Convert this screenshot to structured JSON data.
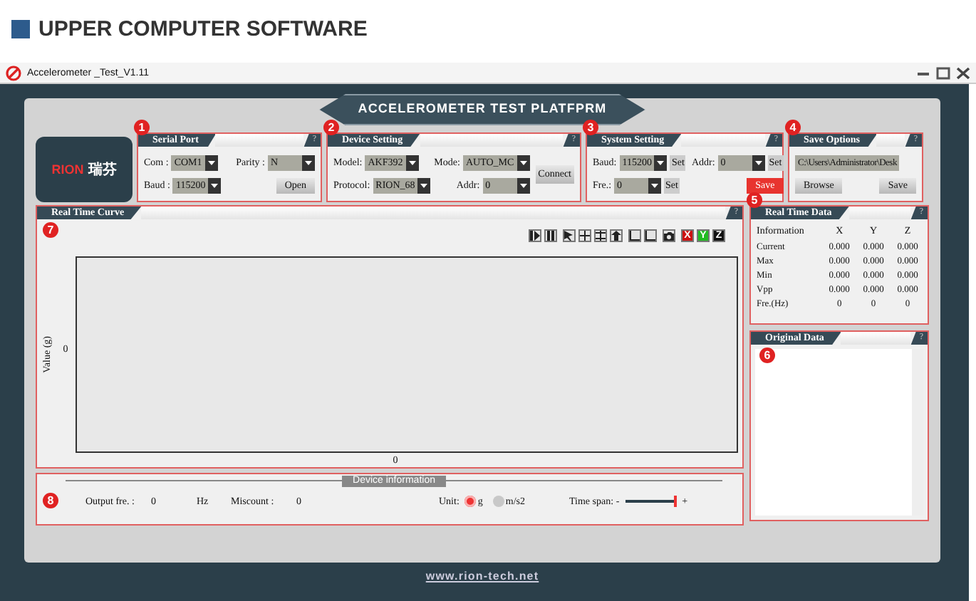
{
  "header": {
    "title": "UPPER COMPUTER SOFTWARE"
  },
  "window": {
    "title": "Accelerometer _Test_V1.11"
  },
  "banner": "ACCELEROMETER TEST PLATFPRM",
  "logo": {
    "brand": "RION",
    "chinese": "瑞芬"
  },
  "panels": [
    {
      "badge": "1",
      "title": "Serial Port",
      "help": "?",
      "rows": [
        [
          {
            "kind": "select",
            "label": "Com :",
            "value": "COM1"
          },
          {
            "kind": "select",
            "label": "Parity :",
            "value": "N"
          }
        ],
        [
          {
            "kind": "select",
            "label": "Baud :",
            "value": "115200"
          },
          {
            "kind": "button",
            "label": "Open"
          }
        ]
      ]
    },
    {
      "badge": "2",
      "title": "Device Setting",
      "help": "?",
      "rows": [
        [
          {
            "kind": "select",
            "label": "Model:",
            "value": "AKF392"
          },
          {
            "kind": "select",
            "label": "Mode:",
            "value": "AUTO_MC"
          }
        ],
        [
          {
            "kind": "select",
            "label": "Protocol:",
            "value": "RION_68"
          },
          {
            "kind": "select",
            "label": "Addr:",
            "value": "0"
          }
        ]
      ],
      "side_button": "Connect"
    },
    {
      "badge": "3",
      "title": "System Setting",
      "help": "?",
      "rows": [
        [
          {
            "kind": "select",
            "label": "Baud:",
            "value": "115200",
            "action": "Set"
          },
          {
            "kind": "select",
            "label": "Addr:",
            "value": "0",
            "action": "Set"
          }
        ],
        [
          {
            "kind": "select",
            "label": "Fre.:",
            "value": "0",
            "action": "Set"
          },
          {
            "kind": "alert-button",
            "label": "Save"
          }
        ]
      ]
    },
    {
      "badge": "4",
      "title": "Save Options",
      "help": "?",
      "rows": [
        [
          {
            "kind": "field",
            "value": "C:\\Users\\Administrator\\Desk"
          }
        ],
        [
          {
            "kind": "button",
            "label": "Browse"
          },
          {
            "kind": "button",
            "label": "Save"
          }
        ]
      ]
    }
  ],
  "curve": {
    "badge": "7",
    "title": "Real Time Curve",
    "help": "?",
    "axis_toggles": [
      {
        "label": "X",
        "color": "#cc1111"
      },
      {
        "label": "Y",
        "color": "#22bb22"
      },
      {
        "label": "Z",
        "color": "#111111"
      }
    ],
    "ylabel": "Value  (g)",
    "ytick": "0",
    "xtick": "0"
  },
  "realtime": {
    "badge": "5",
    "title": "Real Time Data",
    "help": "?",
    "columns": [
      "Information",
      "X",
      "Y",
      "Z"
    ],
    "rows": [
      [
        "Current",
        "0.000",
        "0.000",
        "0.000"
      ],
      [
        "Max",
        "0.000",
        "0.000",
        "0.000"
      ],
      [
        "Min",
        "0.000",
        "0.000",
        "0.000"
      ],
      [
        "Vpp",
        "0.000",
        "0.000",
        "0.000"
      ],
      [
        "Fre.(Hz)",
        "0",
        "0",
        "0"
      ]
    ]
  },
  "original": {
    "badge": "6",
    "title": "Original  Data",
    "help": "?"
  },
  "device_info": {
    "badge": "8",
    "legend": "Device information",
    "output_label": "Output fre. :",
    "output_value": "0",
    "output_unit": "Hz",
    "miscount_label": "Miscount :",
    "miscount_value": "0",
    "unit_label": "Unit:",
    "units": [
      {
        "label": "g",
        "selected": true
      },
      {
        "label": "m/s2",
        "selected": false
      }
    ],
    "span_label": "Time span: -",
    "span_plus": "+",
    "span": {
      "level": 0.95
    }
  },
  "footer": "www.rion-tech.net"
}
